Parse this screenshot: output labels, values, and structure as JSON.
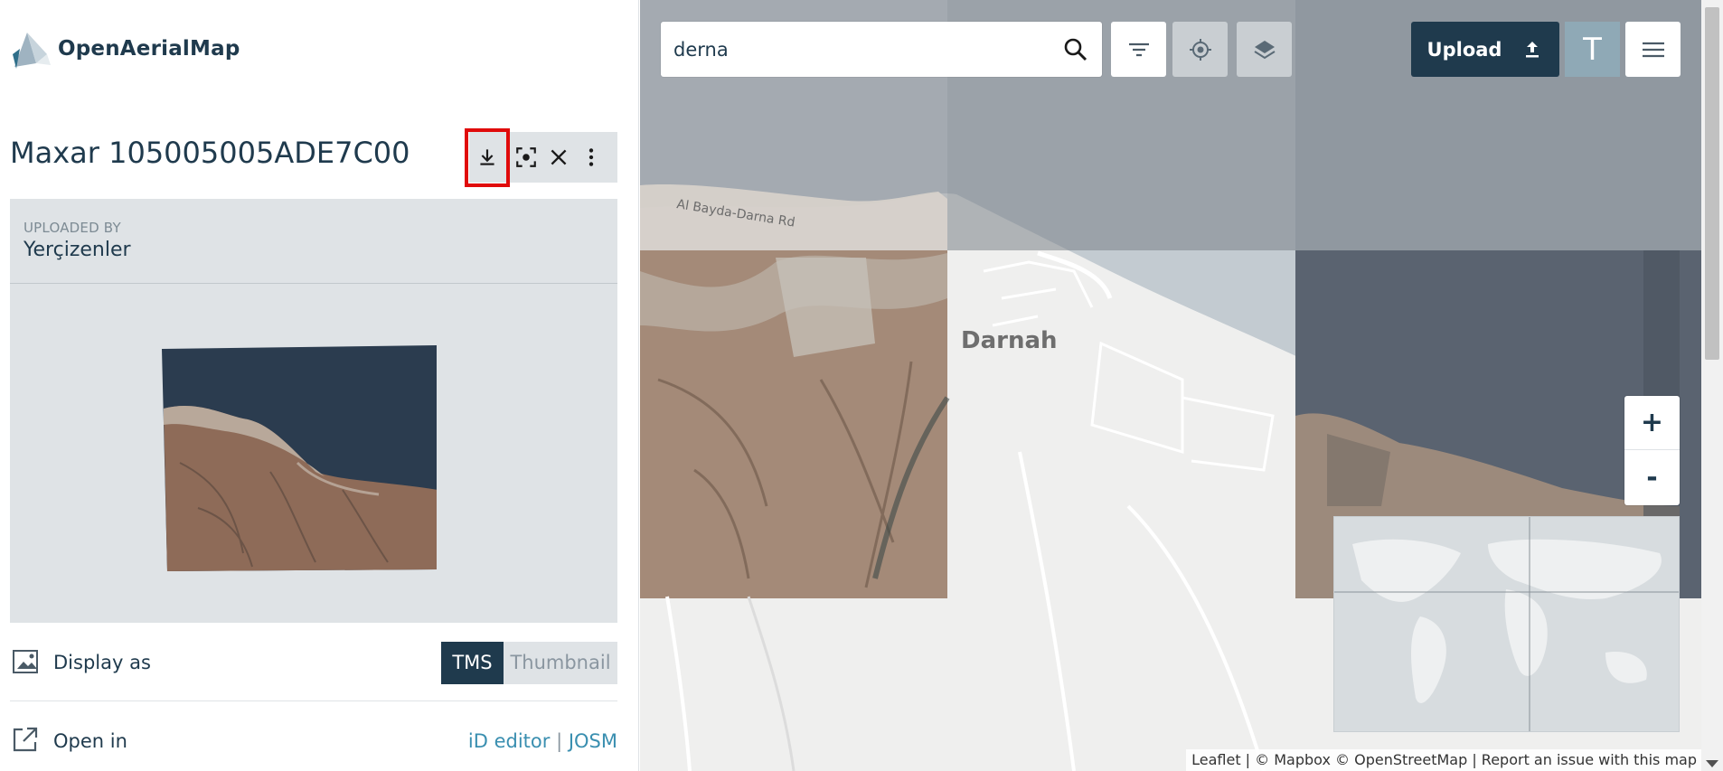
{
  "app": {
    "name": "OpenAerialMap"
  },
  "scene": {
    "title": "Maxar 105005005ADE7C00",
    "uploaded_by_label": "UPLOADED BY",
    "uploaded_by": "Yerçizenler"
  },
  "toolbar": {
    "download_icon": "download-icon",
    "zoom_to_icon": "focus-icon",
    "close_icon": "close-icon",
    "more_icon": "more-vertical-icon",
    "highlight_color": "#e00b0b"
  },
  "display": {
    "label": "Display as",
    "options": [
      "TMS",
      "Thumbnail"
    ],
    "selected": "TMS"
  },
  "open_in": {
    "label": "Open in",
    "id_editor": "iD editor",
    "separator": "|",
    "josm": "JOSM"
  },
  "search": {
    "value": "derna"
  },
  "map": {
    "place_label": "Darnah",
    "road_label": "Al Bayda-Darna Rd",
    "upload_label": "Upload",
    "t_label": "T",
    "zoom_in": "+",
    "zoom_out": "-",
    "attribution": {
      "leaflet": "Leaflet",
      "sep1": " | © ",
      "mapbox": "Mapbox",
      "sep2": " © ",
      "osm": "OpenStreetMap",
      "sep3": " | ",
      "report": "Report an issue with this map"
    }
  },
  "colors": {
    "brand_dark": "#1f3a4d",
    "panel_grey": "#dfe3e6",
    "link_blue": "#3a8fb0"
  }
}
